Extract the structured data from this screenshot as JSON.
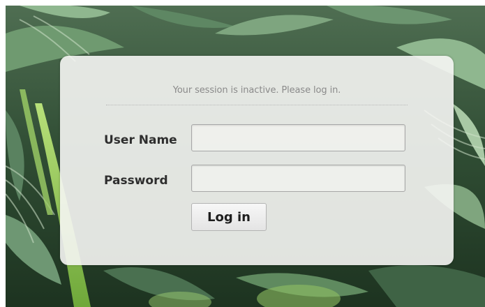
{
  "login": {
    "message": "Your session is inactive. Please log in.",
    "username_label": "User Name",
    "username_value": "",
    "password_label": "Password",
    "password_value": "",
    "submit_label": "Log in"
  },
  "colors": {
    "panel_background": "#f6f6f4",
    "message_text": "#8a8a8a",
    "label_text": "#2e2e2e",
    "foliage_dark": "#2c4a2f",
    "foliage_light": "#8fb78f"
  }
}
